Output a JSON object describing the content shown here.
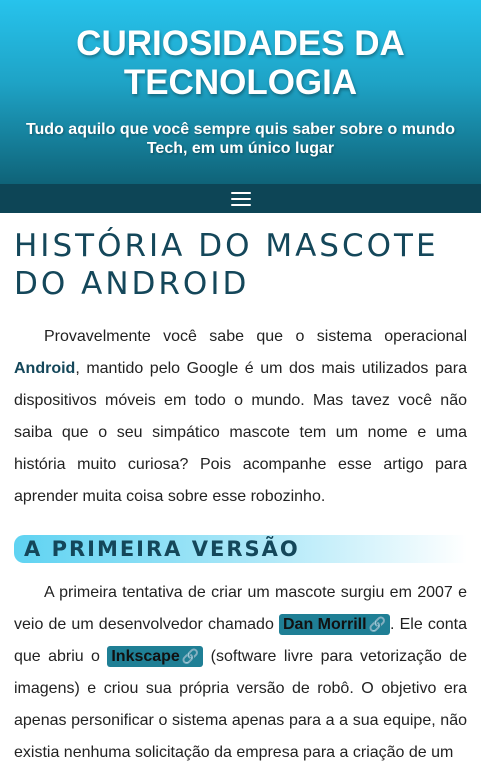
{
  "header": {
    "title": "CURIOSIDADES DA TECNOLOGIA",
    "tagline": "Tudo aquilo que você sempre quis saber sobre o mundo Tech, em um único lugar"
  },
  "nav": {
    "menu_icon": "hamburger-icon"
  },
  "article": {
    "title": "História do Mascote do Android",
    "p1_before": "Provavelmente você sabe que o sistema operacional ",
    "p1_bold": "Android",
    "p1_after": ", mantido pelo Google é um dos mais utilizados para dispositivos móveis em todo o mundo. Mas tavez você não saiba que o seu simpático mascote tem um nome e uma história muito curiosa? Pois acompanhe esse artigo para aprender muita coisa sobre esse robozinho.",
    "section1_title": "A primeira versão",
    "p2_text1": "A primeira tentativa de criar um mascote surgiu em 2007 e veio de um desenvolvedor chamado ",
    "p2_link1": "Dan Morrill",
    "p2_text2": ". Ele conta que abriu o ",
    "p2_link2": "Inkscape",
    "p2_text3": " (software livre para vetorização de imagens) e criou sua própria versão de robô. O objetivo era apenas personificar o sistema apenas para a a sua equipe, não existia nenhuma solicitação da empresa para a criação de um",
    "link_icon": "link-icon"
  }
}
